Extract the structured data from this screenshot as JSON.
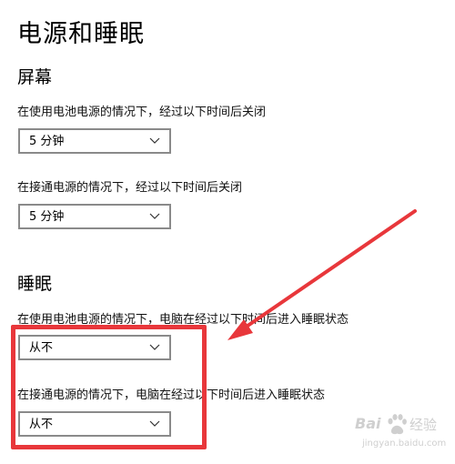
{
  "page": {
    "title": "电源和睡眠"
  },
  "screen": {
    "title": "屏幕",
    "battery_label": "在使用电池电源的情况下，经过以下时间后关闭",
    "battery_value": "5 分钟",
    "plugged_label": "在接通电源的情况下，经过以下时间后关闭",
    "plugged_value": "5 分钟"
  },
  "sleep": {
    "title": "睡眠",
    "battery_label": "在使用电池电源的情况下，电脑在经过以下时间后进入睡眠状态",
    "battery_value": "从不",
    "plugged_label": "在接通电源的情况下，电脑在经过以下时间后进入睡眠状态",
    "plugged_value": "从不"
  },
  "annotation": {
    "color": "#e8373b"
  },
  "watermark": {
    "logo": "Bai",
    "name": "经验",
    "url": "jingyan.baidu.com"
  },
  "icons": {
    "dropdown": "chevron-down-icon",
    "paw": "baidu-paw-icon"
  }
}
